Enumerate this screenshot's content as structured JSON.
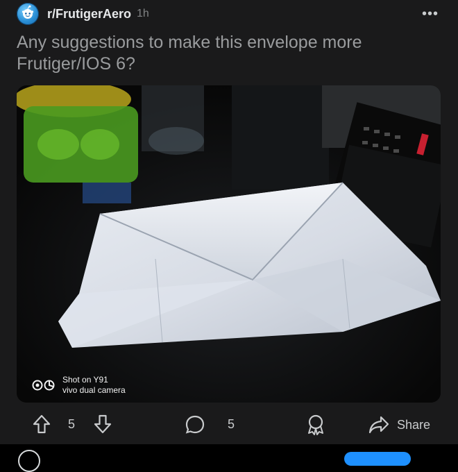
{
  "post": {
    "subreddit": "r/FrutigerAero",
    "time": "1h",
    "more_label": "•••",
    "title": "Any suggestions to make this envelope more Frutiger/IOS 6?"
  },
  "image": {
    "watermark_line1": "Shot on Y91",
    "watermark_line2": "vivo dual camera"
  },
  "actions": {
    "upvotes": "5",
    "comments": "5",
    "share_label": "Share"
  }
}
